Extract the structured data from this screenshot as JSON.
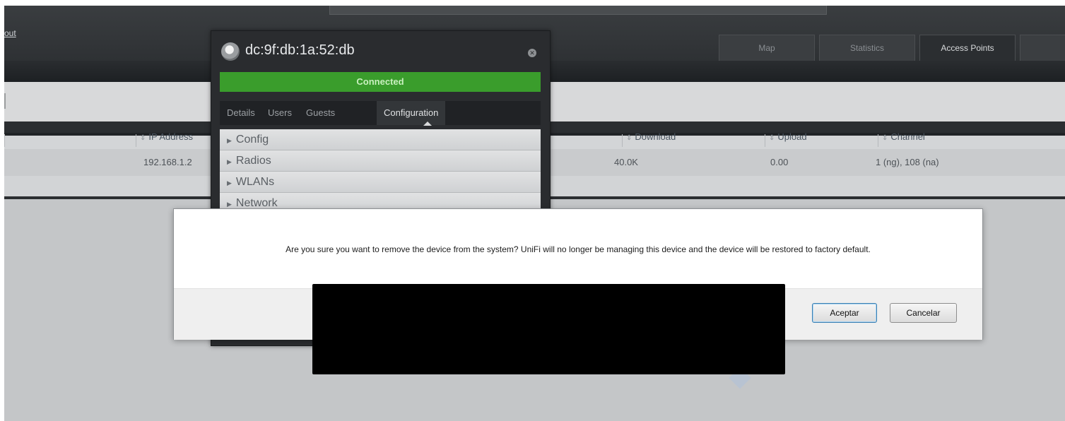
{
  "header": {
    "logout_label": "out",
    "tabs": [
      {
        "label": "Map",
        "active": false
      },
      {
        "label": "Statistics",
        "active": false
      },
      {
        "label": "Access Points",
        "active": true
      },
      {
        "label": "",
        "active": false
      }
    ]
  },
  "table": {
    "columns": [
      "IP Address",
      "Download",
      "Upload",
      "Channel"
    ],
    "row": {
      "ip_address": "192.168.1.2",
      "download": "40.0K",
      "upload": "0.00",
      "channel": "1 (ng), 108 (na)"
    }
  },
  "device_panel": {
    "title": "dc:9f:db:1a:52:db",
    "status": "Connected",
    "status_color": "#3a9d2c",
    "tabs": [
      "Details",
      "Users",
      "Guests",
      "Configuration"
    ],
    "active_tab": "Configuration",
    "sections": [
      "Config",
      "Radios",
      "WLANs",
      "Network"
    ]
  },
  "modal": {
    "message": "Are you sure you want to remove the device from the system? UniFi will no longer be managing this device and the device will be restored to factory default.",
    "accept_label": "Aceptar",
    "cancel_label": "Cancelar"
  }
}
